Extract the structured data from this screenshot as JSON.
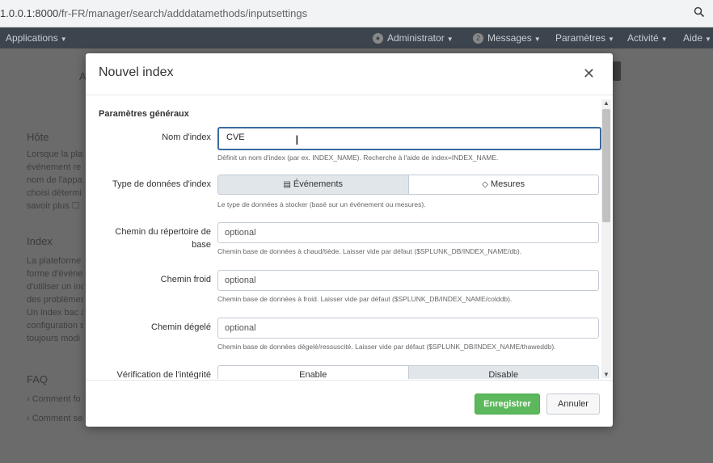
{
  "browser": {
    "url_host": "1.0.0.1:8000",
    "url_path": "/fr-FR/manager/search/adddatamethods/inputsettings",
    "zoom_icon": "magnifier-icon"
  },
  "appbar": {
    "applications": "Applications",
    "administrator": "Administrator",
    "messages_count": "2",
    "messages": "Messages",
    "parametres": "Paramètres",
    "activite": "Activité",
    "aide": "Aide"
  },
  "background": {
    "letter": "A",
    "host_title": "Hôte",
    "host_text": [
      "Lorsque la plate",
      "événement re",
      "nom de l'appa",
      "choisi détermi",
      "savoir plus ☐"
    ],
    "index_title": "Index",
    "index_text": [
      "La plateforme",
      "forme d'événe",
      "d'utiliser un ind",
      "des problèmes",
      "Un index bac à",
      "configuration s",
      "toujours modi"
    ],
    "faq_title": "FAQ",
    "faq_items": [
      "› Comment fo",
      "› Comment se"
    ]
  },
  "modal": {
    "title": "Nouvel index",
    "section": "Paramètres généraux",
    "index_name_label": "Nom d'index",
    "index_name_value": "CVE",
    "index_name_help": "Définit un nom d'index (par ex. INDEX_NAME). Recherche à l'aide de index=INDEX_NAME.",
    "data_type_label": "Type de données d'index",
    "data_type_options": [
      "Événements",
      "Mesures"
    ],
    "data_type_help": "Le type de données à stocker (basé sur un événement ou mesures).",
    "home_path_label": "Chemin du répertoire de base",
    "home_path_placeholder": "optional",
    "home_path_help": "Chemin base de données à chaud/tiède. Laisser vide par défaut ($SPLUNK_DB/INDEX_NAME/db).",
    "cold_path_label": "Chemin froid",
    "cold_path_placeholder": "optional",
    "cold_path_help": "Chemin base de données à froid. Laisser vide par défaut ($SPLUNK_DB/INDEX_NAME/colddb).",
    "thawed_path_label": "Chemin dégelé",
    "thawed_path_placeholder": "optional",
    "thawed_path_help": "Chemin base de données dégelé/ressuscité. Laisser vide par défaut ($SPLUNK_DB/INDEX_NAME/thaweddb).",
    "integrity_label": "Vérification de l'intégrité",
    "integrity_options": [
      "Enable",
      "Disable"
    ],
    "save_button": "Enregistrer",
    "cancel_button": "Annuler"
  }
}
